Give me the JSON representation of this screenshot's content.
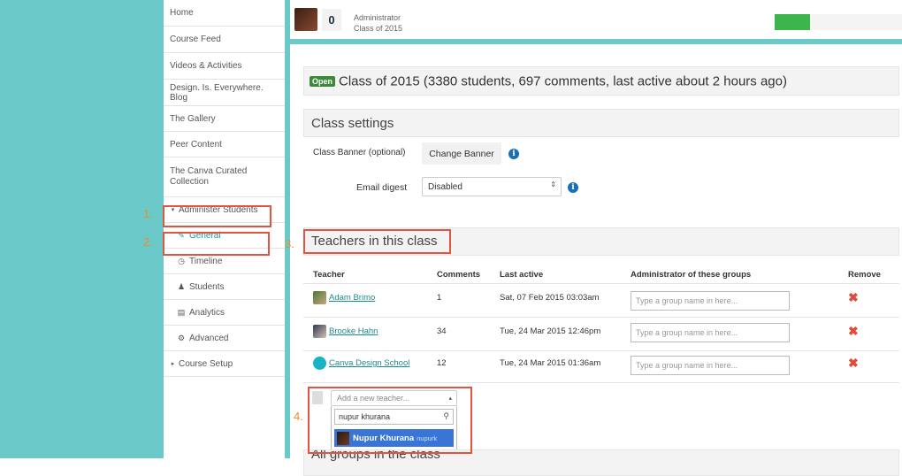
{
  "sidebar": {
    "items": [
      {
        "label": "Home"
      },
      {
        "label": "Course Feed"
      },
      {
        "label": "Videos & Activities"
      },
      {
        "label": "Design. Is. Everywhere. Blog"
      },
      {
        "label": "The Gallery"
      },
      {
        "label": "Peer Content"
      },
      {
        "label": "The Canva Curated Collection"
      },
      {
        "label": "Administer Students"
      },
      {
        "label": "General"
      },
      {
        "label": "Timeline"
      },
      {
        "label": "Students"
      },
      {
        "label": "Analytics"
      },
      {
        "label": "Advanced"
      },
      {
        "label": "Course Setup"
      }
    ]
  },
  "topbar": {
    "count": "0",
    "role": "Administrator",
    "class_name": "Class of 2015"
  },
  "class_header": {
    "badge": "Open",
    "title": "Class of 2015 (3380 students, 697 comments, last active about 2 hours ago)"
  },
  "settings": {
    "heading": "Class settings",
    "banner_label": "Class Banner (optional)",
    "banner_button": "Change Banner",
    "digest_label": "Email digest",
    "digest_value": "Disabled"
  },
  "teachers": {
    "heading": "Teachers in this class",
    "columns": [
      "Teacher",
      "Comments",
      "Last active",
      "Administrator of these groups",
      "Remove"
    ],
    "group_placeholder": "Type a group name in here...",
    "rows": [
      {
        "name": "Adam Brimo",
        "comments": "1",
        "last_active": "Sat, 07 Feb 2015 03:03am"
      },
      {
        "name": "Brooke Hahn",
        "comments": "34",
        "last_active": "Tue, 24 Mar 2015 12:46pm"
      },
      {
        "name": "Canva Design School",
        "comments": "12",
        "last_active": "Tue, 24 Mar 2015 01:36am"
      }
    ],
    "add_placeholder": "Add a new teacher...",
    "search_value": "nupur khurana",
    "result_name": "Nupur Khurana",
    "result_handle": "nupurk"
  },
  "annotations": [
    "1.",
    "2.",
    "3.",
    "4."
  ],
  "next_heading": "All groups in the class",
  "colors": {
    "accent": "#1f9a9a",
    "teal_bg": "#6bc9c9",
    "highlight": "#e2543f",
    "green": "#3cb54a",
    "remove": "#e04b3c"
  }
}
